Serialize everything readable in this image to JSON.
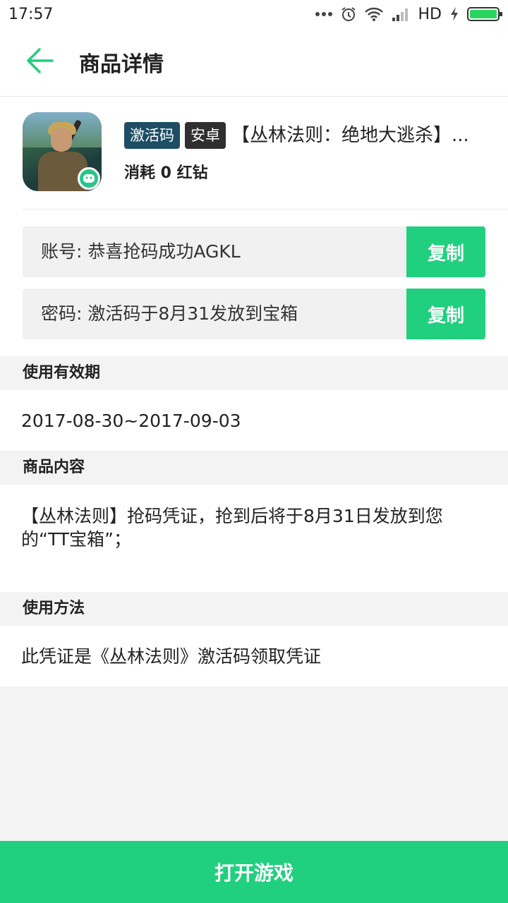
{
  "status_bar": {
    "time": "17:57",
    "network": "HD",
    "icons": [
      "more-dots-icon",
      "alarm-icon",
      "wifi-icon",
      "signal-icon",
      "charging-icon",
      "battery-icon"
    ],
    "battery_color": "#2bd65e"
  },
  "header": {
    "title": "商品详情",
    "back_icon": "arrow-left-icon",
    "accent_color": "#20d07e"
  },
  "product": {
    "tags": {
      "type": "激活码",
      "platform": "安卓"
    },
    "name": "【丛林法则：绝地大逃杀】...",
    "cost": "消耗 0 红钻",
    "account": {
      "text": "账号: 恭喜抢码成功AGKL",
      "copy_label": "复制"
    },
    "password": {
      "text": "密码: 激活码于8月31发放到宝箱",
      "copy_label": "复制"
    }
  },
  "sections": {
    "validity": {
      "title": "使用有效期",
      "body": "2017-08-30~2017-09-03"
    },
    "content": {
      "title": "商品内容",
      "body": "【丛林法则】抢码凭证，抢到后将于8月31日发放到您的“TT宝箱”；"
    },
    "usage": {
      "title": "使用方法",
      "body": "此凭证是《丛林法则》激活码领取凭证"
    }
  },
  "footer": {
    "open_game_label": "打开游戏"
  }
}
